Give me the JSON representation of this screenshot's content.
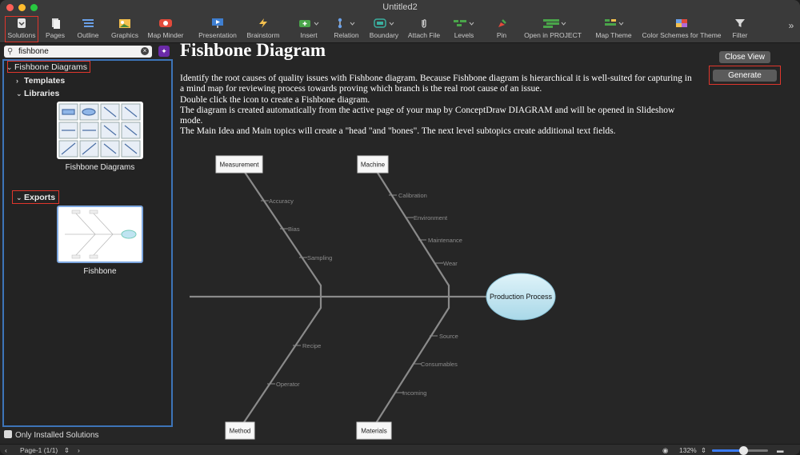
{
  "window": {
    "title": "Untitled2"
  },
  "toolbar": {
    "items": [
      {
        "label": "Solutions",
        "icon": "solutions-icon"
      },
      {
        "label": "Pages",
        "icon": "pages-icon"
      },
      {
        "label": "Outline",
        "icon": "outline-icon"
      },
      {
        "label": "Graphics",
        "icon": "graphics-icon"
      },
      {
        "label": "Map Minder",
        "icon": "map-minder-icon"
      },
      {
        "label": "Presentation",
        "icon": "presentation-icon"
      },
      {
        "label": "Brainstorm",
        "icon": "brainstorm-icon"
      },
      {
        "label": "Insert",
        "icon": "insert-icon"
      },
      {
        "label": "Relation",
        "icon": "relation-icon"
      },
      {
        "label": "Boundary",
        "icon": "boundary-icon"
      },
      {
        "label": "Attach File",
        "icon": "attach-file-icon"
      },
      {
        "label": "Levels",
        "icon": "levels-icon"
      },
      {
        "label": "Pin",
        "icon": "pin-icon"
      },
      {
        "label": "Open in PROJECT",
        "icon": "open-in-project-icon"
      },
      {
        "label": "Map Theme",
        "icon": "map-theme-icon"
      },
      {
        "label": "Color Schemes for Theme",
        "icon": "color-schemes-icon"
      },
      {
        "label": "Filter",
        "icon": "filter-icon"
      }
    ],
    "overflow": "»"
  },
  "sidebar": {
    "search_value": "fishbone",
    "tree": {
      "root": "Fishbone Diagrams",
      "templates": "Templates",
      "libraries": "Libraries",
      "library_name": "Fishbone Diagrams",
      "exports": "Exports",
      "export_name": "Fishbone"
    },
    "only_installed": "Only Installed Solutions"
  },
  "main": {
    "title": "Fishbone Diagram",
    "description": [
      "Identify the root causes of quality issues with Fishbone diagram. Because Fishbone diagram is hierarchical it is well-suited for capturing in a mind map for reviewing process towards proving which branch is the real root cause of an issue.",
      "Double click the icon to create a Fishbone diagram.",
      "The diagram is created automatically from the active page of your map by ConceptDraw DIAGRAM and will be opened in Slideshow mode.",
      "The Main Idea and Main topics will create a \"head \"and \"bones\". The next level subtopics create additional text fields."
    ],
    "close_view": "Close View",
    "generate": "Generate"
  },
  "diagram": {
    "head": "Production Process",
    "categories": {
      "measurement": "Measurement",
      "machine": "Machine",
      "method": "Method",
      "materials": "Materials"
    },
    "causes": {
      "measurement": [
        "Accuracy",
        "Bias",
        "Sampling"
      ],
      "machine": [
        "Calibration",
        "Environment",
        "Maintenance",
        "Wear"
      ],
      "method": [
        "Recipe",
        "Operator"
      ],
      "materials": [
        "Source",
        "Consumables",
        "Incoming"
      ]
    }
  },
  "statusbar": {
    "page": "Page-1 (1/1)",
    "zoom": "132%",
    "zoom_level": 0.55
  }
}
